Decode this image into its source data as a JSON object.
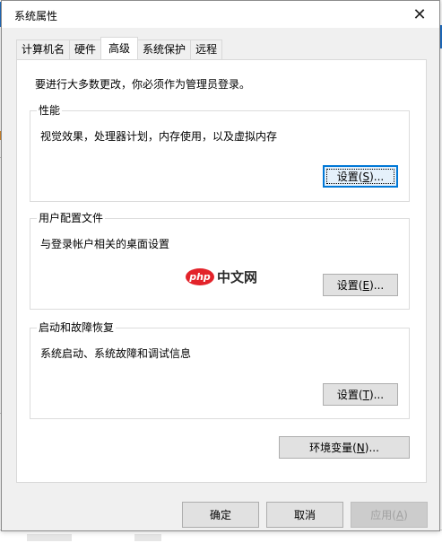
{
  "dialog": {
    "title": "系统属性",
    "close_glyph": "✕"
  },
  "tabs": [
    {
      "label": "计算机名"
    },
    {
      "label": "硬件"
    },
    {
      "label": "高级"
    },
    {
      "label": "系统保护"
    },
    {
      "label": "远程"
    }
  ],
  "active_tab": "高级",
  "panel": {
    "intro": "要进行大多数更改，你必须作为管理员登录。",
    "performance": {
      "label": "性能",
      "description": "视觉效果，处理器计划，内存使用，以及虚拟内存",
      "button": {
        "prefix": "设置(",
        "key": "S",
        "suffix": ")..."
      }
    },
    "user_profiles": {
      "label": "用户配置文件",
      "description": "与登录帐户相关的桌面设置",
      "button": {
        "prefix": "设置(",
        "key": "E",
        "suffix": ")..."
      }
    },
    "startup_recovery": {
      "label": "启动和故障恢复",
      "description": "系统启动、系统故障和调试信息",
      "button": {
        "prefix": "设置(",
        "key": "T",
        "suffix": ")..."
      }
    },
    "env_button": {
      "prefix": "环境变量(",
      "key": "N",
      "suffix": ")..."
    }
  },
  "watermark": {
    "badge": "php",
    "text": "中文网"
  },
  "footer": {
    "ok": "确定",
    "cancel": "取消",
    "apply": {
      "prefix": "应用(",
      "key": "A",
      "suffix": ")"
    }
  },
  "colors": {
    "accent": "#0078d7",
    "watermark_red": "#e3232a"
  }
}
